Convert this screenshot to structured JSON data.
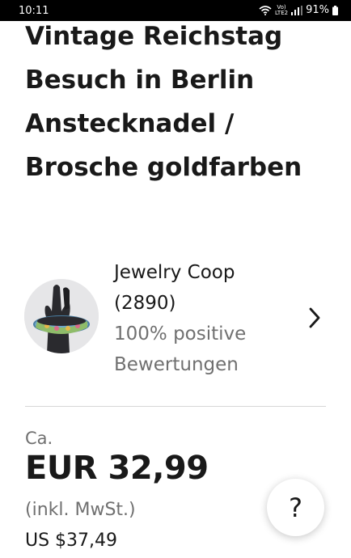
{
  "status_bar": {
    "time": "10:11",
    "network_label_top": "Vo)",
    "network_label_bottom": "LTE2",
    "battery_percent": "91%"
  },
  "listing": {
    "title": "Vintage Reichstag Besuch in Berlin Anstecknadel / Brosche goldfarben"
  },
  "seller": {
    "name": "Jewelry Coop",
    "feedback_count": "(2890)",
    "positive": "100% positive",
    "reviews_label": "Bewertungen"
  },
  "price": {
    "prefix": "Ca.",
    "amount": "EUR 32,99",
    "vat_note": "(inkl. MwSt.)",
    "converted": "US $37,49"
  },
  "help": {
    "label": "?"
  },
  "colors": {
    "text_primary": "#191919",
    "text_secondary": "#707070",
    "divider": "#d6d6d6"
  }
}
